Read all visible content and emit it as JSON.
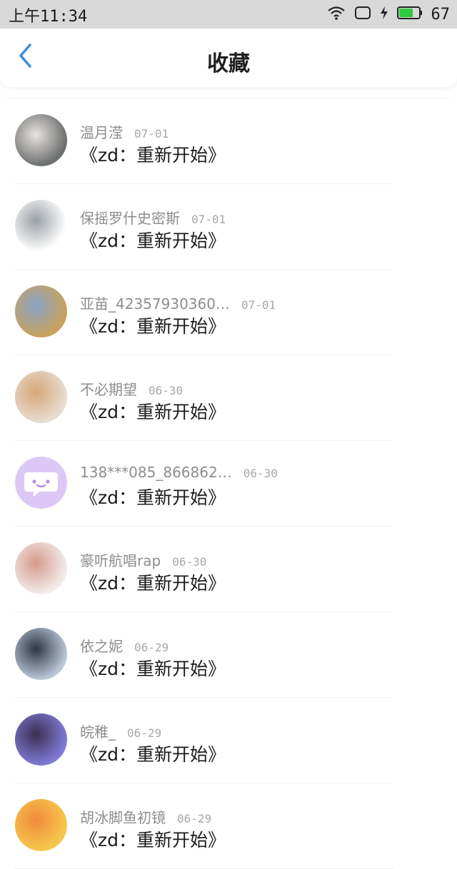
{
  "status_bar": {
    "time": "上午11:34",
    "battery": "67"
  },
  "header": {
    "title": "收藏"
  },
  "favorites": [
    {
      "username": "温月滢",
      "date": "07-01",
      "title": "《zd：重新开始》",
      "avatar": {
        "bg": "#6b6f6e",
        "accent": "#e9e3df"
      }
    },
    {
      "username": "保摇罗什史密斯",
      "date": "07-01",
      "title": "《zd：重新开始》",
      "avatar": {
        "bg": "#ffffff",
        "accent": "#9aa0a6"
      }
    },
    {
      "username": "亚苗_42357930360…",
      "date": "07-01",
      "title": "《zd：重新开始》",
      "avatar": {
        "bg": "#c8a15a",
        "accent": "#8aa3c8"
      }
    },
    {
      "username": "不必期望",
      "date": "06-30",
      "title": "《zd：重新开始》",
      "avatar": {
        "bg": "#e8dcd0",
        "accent": "#d6a77a"
      }
    },
    {
      "username": "138***085_866862…",
      "date": "06-30",
      "title": "《zd：重新开始》",
      "avatar": {
        "bg": "#dcc8f5",
        "accent": "#c9a9f0"
      }
    },
    {
      "username": "豪听航唱rap",
      "date": "06-30",
      "title": "《zd：重新开始》",
      "avatar": {
        "bg": "#f2ecea",
        "accent": "#d69a8c"
      }
    },
    {
      "username": "依之妮",
      "date": "06-29",
      "title": "《zd：重新开始》",
      "avatar": {
        "bg": "#b9c7d8",
        "accent": "#2f3645"
      }
    },
    {
      "username": "皖稚_",
      "date": "06-29",
      "title": "《zd：重新开始》",
      "avatar": {
        "bg": "#7f7bd6",
        "accent": "#3c2f52"
      }
    },
    {
      "username": "胡冰脚鱼初镜",
      "date": "06-29",
      "title": "《zd：重新开始》",
      "avatar": {
        "bg": "#f6c84c",
        "accent": "#f08a3c"
      }
    }
  ],
  "colors": {
    "accent": "#3a8ee6",
    "status_bar_bg": "#d9d9d9",
    "battery_green": "#2ecc40"
  }
}
